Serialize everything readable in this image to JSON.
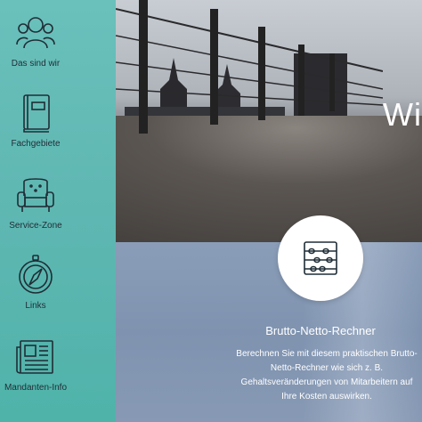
{
  "hero": {
    "title": "Wi"
  },
  "sidebar": {
    "items": [
      {
        "label": "Das sind wir",
        "icon": "team-icon"
      },
      {
        "label": "Fachgebiete",
        "icon": "book-icon"
      },
      {
        "label": "Service-Zone",
        "icon": "armchair-icon"
      },
      {
        "label": "Links",
        "icon": "compass-icon"
      },
      {
        "label": "Mandanten-Info",
        "icon": "newspaper-icon"
      }
    ]
  },
  "feature": {
    "icon": "abacus-icon",
    "title": "Brutto-Netto-Rechner",
    "text": "Berechnen Sie mit diesem praktischen Brutto-Netto-Rechner wie sich z. B. Gehaltsveränderungen von Mitarbeitern auf Ihre Kosten auswirken."
  },
  "colors": {
    "sidebar": "#5fb7b2",
    "icon_stroke": "#1f2d36",
    "lower_bg": "#8a9db8"
  }
}
